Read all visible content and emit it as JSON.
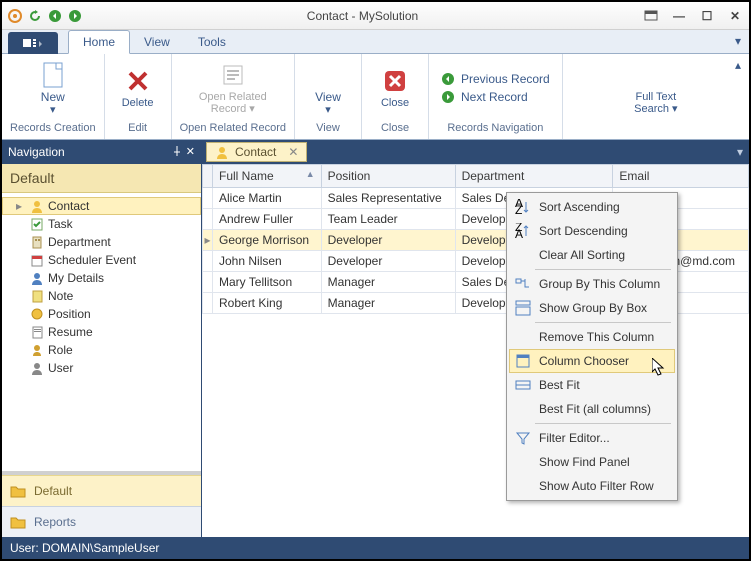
{
  "window": {
    "title": "Contact - MySolution"
  },
  "tabs": {
    "home": "Home",
    "view": "View",
    "tools": "Tools"
  },
  "ribbon": {
    "new": "New",
    "records_creation": "Records Creation",
    "delete": "Delete",
    "edit": "Edit",
    "open_related": "Open Related\nRecord",
    "open_related_group": "Open Related Record",
    "view": "View",
    "view_group": "View",
    "close": "Close",
    "close_group": "Close",
    "prev": "Previous Record",
    "next": "Next Record",
    "records_nav": "Records Navigation",
    "fulltext": "Full Text\nSearch"
  },
  "nav": {
    "title": "Navigation",
    "default": "Default",
    "items": [
      {
        "label": "Contact",
        "icon": "person",
        "sel": true,
        "exp": "▸"
      },
      {
        "label": "Task",
        "icon": "task"
      },
      {
        "label": "Department",
        "icon": "dept"
      },
      {
        "label": "Scheduler Event",
        "icon": "sched"
      },
      {
        "label": "My Details",
        "icon": "person2"
      },
      {
        "label": "Note",
        "icon": "note"
      },
      {
        "label": "Position",
        "icon": "pos"
      },
      {
        "label": "Resume",
        "icon": "resume"
      },
      {
        "label": "Role",
        "icon": "role"
      },
      {
        "label": "User",
        "icon": "user"
      }
    ],
    "acc_default": "Default",
    "acc_reports": "Reports"
  },
  "content_tab": {
    "label": "Contact"
  },
  "grid": {
    "cols": [
      "Full Name",
      "Position",
      "Department",
      "Email"
    ],
    "rows": [
      {
        "name": "Alice Martin",
        "pos": "Sales Representative",
        "dept": "Sales Department",
        "email": ""
      },
      {
        "name": "Andrew Fuller",
        "pos": "Team Leader",
        "dept": "Development Department",
        "email": ""
      },
      {
        "name": "George Morrison",
        "pos": "Developer",
        "dept": "Development Department",
        "email": "",
        "sel": true
      },
      {
        "name": "John Nilsen",
        "pos": "Developer",
        "dept": "Development Department",
        "email": "john_nilsen@md.com"
      },
      {
        "name": "Mary Tellitson",
        "pos": "Manager",
        "dept": "Sales Department",
        "email": ""
      },
      {
        "name": "Robert King",
        "pos": "Manager",
        "dept": "Development Department",
        "email": ""
      }
    ]
  },
  "context_menu": [
    {
      "label": "Sort Ascending",
      "icon": "sort-asc"
    },
    {
      "label": "Sort Descending",
      "icon": "sort-desc"
    },
    {
      "label": "Clear All Sorting"
    },
    {
      "sep": true
    },
    {
      "label": "Group By This Column",
      "icon": "group"
    },
    {
      "label": "Show Group By Box",
      "icon": "groupbox"
    },
    {
      "sep": true
    },
    {
      "label": "Remove This Column"
    },
    {
      "label": "Column Chooser",
      "icon": "chooser",
      "hl": true
    },
    {
      "label": "Best Fit",
      "icon": "fit"
    },
    {
      "label": "Best Fit (all columns)"
    },
    {
      "sep": true
    },
    {
      "label": "Filter Editor...",
      "icon": "filter"
    },
    {
      "label": "Show Find Panel"
    },
    {
      "label": "Show Auto Filter Row"
    }
  ],
  "status": "User: DOMAIN\\SampleUser"
}
